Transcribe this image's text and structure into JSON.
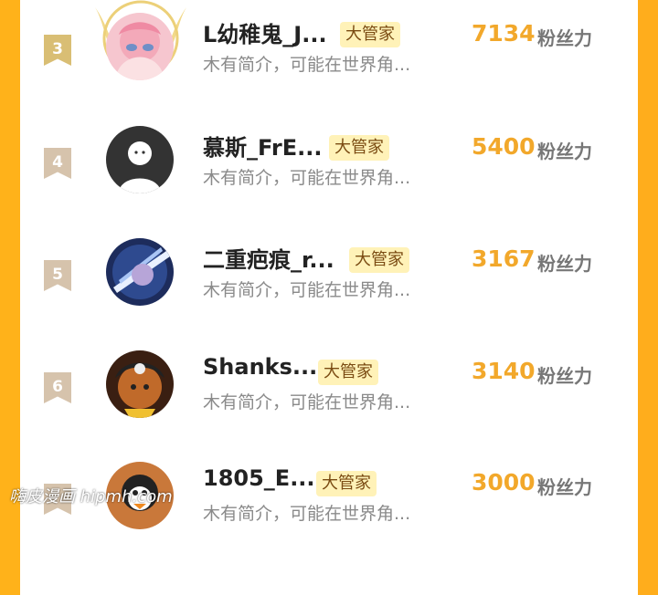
{
  "leaderboard": {
    "entries": [
      {
        "rank": "3",
        "name": "L幼稚鬼_J...",
        "badge": "大管家",
        "intro": "木有简介，可能在世界角...",
        "score": "7134",
        "unit": "粉丝力"
      },
      {
        "rank": "4",
        "name": "慕斯_FrE...",
        "badge": "大管家",
        "intro": "木有简介，可能在世界角...",
        "score": "5400",
        "unit": "粉丝力"
      },
      {
        "rank": "5",
        "name": "二重疤痕_r...",
        "badge": "大管家",
        "intro": "木有简介，可能在世界角...",
        "score": "3167",
        "unit": "粉丝力"
      },
      {
        "rank": "6",
        "name": "Shanks...",
        "badge": "大管家",
        "intro": "木有简介，可能在世界角...",
        "score": "3140",
        "unit": "粉丝力"
      },
      {
        "rank": "",
        "name": "1805_E...",
        "badge": "大管家",
        "intro": "木有简介，可能在世界角...",
        "score": "3000",
        "unit": "粉丝力"
      }
    ]
  },
  "watermark": "嗨皮漫画 hipmh.com",
  "colors": {
    "side_accent": "#ffb21a",
    "score": "#f2a82b",
    "badge_bg": "#fff2b8",
    "badge_text": "#7a4b12",
    "gold_ribbon": "#d9be74",
    "plain_ribbon": "#d6c3ac"
  }
}
